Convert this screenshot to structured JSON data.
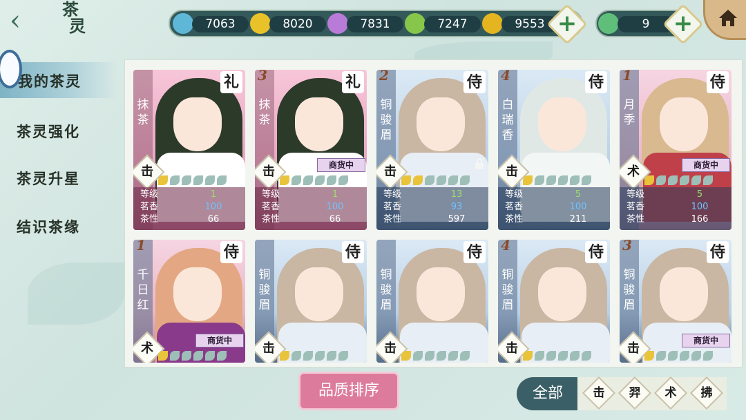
{
  "header": {
    "title_line1": "茶",
    "title_line2": "灵",
    "back_icon": "chevron-left-icon",
    "home_icon": "home-icon"
  },
  "resources": [
    {
      "name": "water-gem-icon",
      "color": "#5fb7d8",
      "value": "7063"
    },
    {
      "name": "gold-gem-icon",
      "color": "#e9c22a",
      "value": "8020"
    },
    {
      "name": "purple-gem-icon",
      "color": "#b97bd8",
      "value": "7831"
    },
    {
      "name": "green-gem-icon",
      "color": "#86c64a",
      "value": "7247"
    },
    {
      "name": "gold-coin-icon",
      "color": "#e4b520",
      "value": "9553"
    }
  ],
  "jade": {
    "icon": "jade-icon",
    "value": "9"
  },
  "menu": {
    "active": "我的茶灵",
    "items": [
      "茶灵强化",
      "茶灵升星",
      "结识茶缘"
    ]
  },
  "stat_labels": {
    "level": "等级",
    "aroma": "茗香",
    "nature": "茶性"
  },
  "cards": [
    {
      "star": "",
      "name": "抹茶",
      "cls": "礼",
      "type": "击",
      "theme": "pink",
      "hair": "#2c3a2a",
      "body": "#ffffff",
      "gold_leaves": 1,
      "level": "1",
      "aroma": "100",
      "nature": "66",
      "status": "",
      "locked": false
    },
    {
      "star": "3",
      "name": "抹茶",
      "cls": "礼",
      "type": "击",
      "theme": "pink",
      "hair": "#2c3a2a",
      "body": "#ffffff",
      "gold_leaves": 1,
      "level": "1",
      "aroma": "100",
      "nature": "66",
      "status": "商货中",
      "locked": false
    },
    {
      "star": "2",
      "name": "铜骏眉",
      "cls": "侍",
      "type": "击",
      "theme": "blue",
      "hair": "#c9b7a3",
      "body": "#e8eef5",
      "gold_leaves": 2,
      "level": "13",
      "aroma": "93",
      "nature": "597",
      "status": "",
      "locked": true
    },
    {
      "star": "4",
      "name": "白瑞香",
      "cls": "侍",
      "type": "击",
      "theme": "blue",
      "hair": "#e0e8e6",
      "body": "#f2f6f5",
      "gold_leaves": 1,
      "level": "5",
      "aroma": "100",
      "nature": "211",
      "status": "",
      "locked": true
    },
    {
      "star": "1",
      "name": "月季",
      "cls": "侍",
      "type": "术",
      "theme": "gold",
      "hair": "#d8b990",
      "body": "#c0404a",
      "gold_leaves": 1,
      "level": "5",
      "aroma": "100",
      "nature": "166",
      "status": "商货中",
      "locked": false
    },
    {
      "star": "1",
      "name": "千日红",
      "cls": "侍",
      "type": "术",
      "theme": "gold",
      "hair": "#e3a883",
      "body": "#8a3a8a",
      "gold_leaves": 1,
      "status": "商货中"
    },
    {
      "star": "",
      "name": "铜骏眉",
      "cls": "侍",
      "type": "击",
      "theme": "blue",
      "hair": "#c9b7a3",
      "body": "#e8eef5",
      "gold_leaves": 1,
      "status": ""
    },
    {
      "star": "",
      "name": "铜骏眉",
      "cls": "侍",
      "type": "击",
      "theme": "blue",
      "hair": "#c9b7a3",
      "body": "#e8eef5",
      "gold_leaves": 1,
      "status": ""
    },
    {
      "star": "4",
      "name": "铜骏眉",
      "cls": "侍",
      "type": "击",
      "theme": "blue",
      "hair": "#c9b7a3",
      "body": "#e8eef5",
      "gold_leaves": 1,
      "status": ""
    },
    {
      "star": "3",
      "name": "铜骏眉",
      "cls": "侍",
      "type": "击",
      "theme": "blue",
      "hair": "#c9b7a3",
      "body": "#e8eef5",
      "gold_leaves": 1,
      "status": "商货中"
    }
  ],
  "bottom": {
    "sort_label": "品质排序",
    "filter_all": "全部",
    "filters": [
      "击",
      "羿",
      "术",
      "拂"
    ]
  }
}
